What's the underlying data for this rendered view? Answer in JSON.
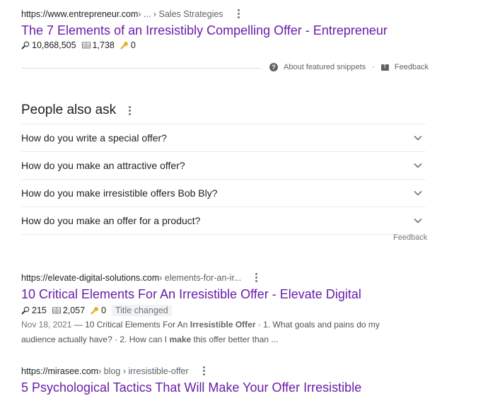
{
  "results": [
    {
      "url_base": "https://www.entrepreneur.com",
      "url_path": " › ... › Sales Strategies",
      "title": "The 7 Elements of an Irresistibly Compelling Offer - Entrepreneur",
      "metrics": {
        "search_icon": "magnifier-icon",
        "searches": "10,868,505",
        "book_icon": "book-icon",
        "pages": "1,738",
        "key_icon": "key-icon",
        "keys": "0"
      }
    },
    {
      "url_base": "https://elevate-digital-solutions.com",
      "url_path": " › elements-for-an-ir...",
      "title": "10 Critical Elements For An Irresistible Offer - Elevate Digital",
      "metrics": {
        "searches": "215",
        "pages": "2,057",
        "keys": "0",
        "badge": "Title changed"
      },
      "snippet": {
        "date": "Nov 18, 2021",
        "dash": " — ",
        "part1": "10 Critical Elements For An ",
        "bold1": "Irresistible Offer",
        "part2": " · 1. What goals and pains do my audience actually have? · 2. How can I ",
        "bold2": "make",
        "part3": " this offer better than ..."
      }
    },
    {
      "url_base": "https://mirasee.com",
      "url_path": " › blog › irresistible-offer",
      "title": "5 Psychological Tactics That Will Make Your Offer Irresistible"
    }
  ],
  "featured_snippet_footer": {
    "about": "About featured snippets",
    "separator": "·",
    "feedback": "Feedback"
  },
  "people_also_ask": {
    "heading": "People also ask",
    "questions": [
      "How do you write a special offer?",
      "How do you make an attractive offer?",
      "How do you make irresistible offers Bob Bly?",
      "How do you make an offer for a product?"
    ],
    "feedback": "Feedback"
  },
  "colors": {
    "visited_link": "#681da8",
    "text": "#202124",
    "muted": "#5f6368"
  }
}
